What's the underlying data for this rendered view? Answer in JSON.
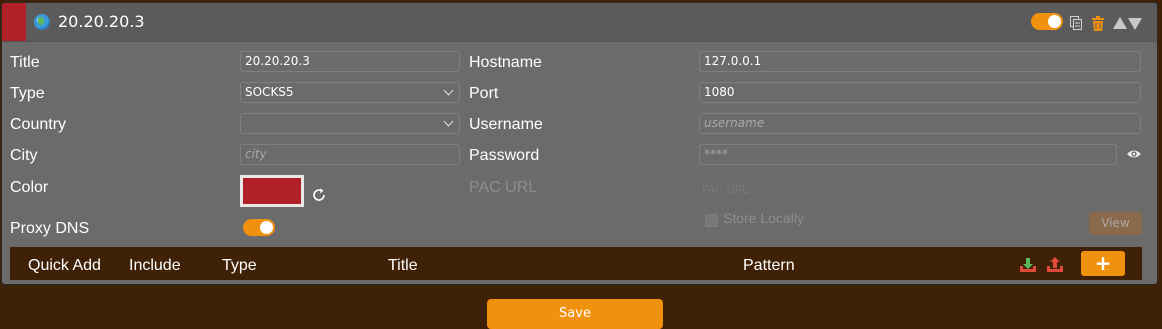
{
  "colors": {
    "accent": "#f0920e",
    "proxy_color": "#b02026",
    "page_background": "#3f2108",
    "card_background": "#6b6b6b"
  },
  "header": {
    "title": "20.20.20.3",
    "icon": "globe-icon",
    "enabled": true,
    "actions": [
      "copy-icon",
      "trash-icon",
      "move-up-icon",
      "move-down-icon"
    ]
  },
  "form": {
    "title": {
      "label": "Title",
      "value": "20.20.20.3"
    },
    "type": {
      "label": "Type",
      "value": "SOCKS5"
    },
    "country": {
      "label": "Country",
      "value": ""
    },
    "city": {
      "label": "City",
      "placeholder": "city"
    },
    "color": {
      "label": "Color"
    },
    "proxy_dns": {
      "label": "Proxy DNS",
      "enabled": true
    },
    "hostname": {
      "label": "Hostname",
      "value": "127.0.0.1"
    },
    "port": {
      "label": "Port",
      "value": "1080"
    },
    "username": {
      "label": "Username",
      "placeholder": "username"
    },
    "password": {
      "label": "Password",
      "placeholder": "****"
    },
    "pac_url": {
      "label": "PAC URL",
      "placeholder": "PAC URL"
    },
    "store_locally": {
      "label": "Store Locally",
      "checked": false
    },
    "view_label": "View"
  },
  "patterns": {
    "columns": [
      "Quick Add",
      "Include",
      "Type",
      "Title",
      "Pattern"
    ],
    "add_label": "+"
  },
  "save_label": "Save"
}
